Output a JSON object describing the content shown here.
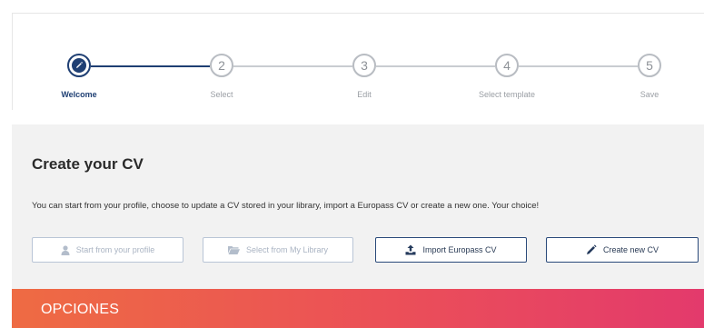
{
  "stepper": {
    "steps": [
      {
        "number": "",
        "label": "Welcome",
        "active": true,
        "icon": "pencil-icon"
      },
      {
        "number": "2",
        "label": "Select",
        "active": false
      },
      {
        "number": "3",
        "label": "Edit",
        "active": false
      },
      {
        "number": "4",
        "label": "Select template",
        "active": false
      },
      {
        "number": "5",
        "label": "Save",
        "active": false
      }
    ]
  },
  "main": {
    "title": "Create your CV",
    "description": "You can start from your profile, choose to update a CV stored in your library, import a Europass CV or create a new one. Your choice!",
    "buttons": [
      {
        "label": "Start from your profile",
        "icon": "user-icon",
        "enabled": false
      },
      {
        "label": "Select from My Library",
        "icon": "folder-icon",
        "enabled": false
      },
      {
        "label": "Import Europass CV",
        "icon": "upload-icon",
        "enabled": true
      },
      {
        "label": "Create new CV",
        "icon": "pencil-icon",
        "enabled": true
      }
    ]
  },
  "banner": {
    "text": "OPCIONES"
  },
  "colors": {
    "primary": "#1f3f73",
    "inactive": "#b8bcc2",
    "panel": "#f2f2f2",
    "banner_start": "#ee6b43",
    "banner_end": "#e33a6c"
  }
}
